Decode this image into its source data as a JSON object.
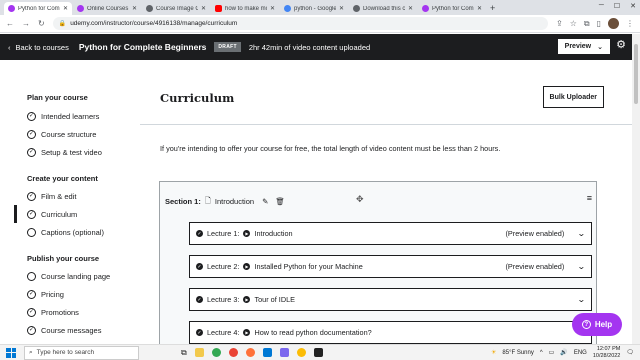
{
  "browser": {
    "tabs": [
      {
        "title": "Python for Comp",
        "color": "#a435f0",
        "active": true
      },
      {
        "title": "Online Courses -",
        "color": "#a435f0",
        "active": false
      },
      {
        "title": "Course Image Gu",
        "color": "#5f6368",
        "active": false
      },
      {
        "title": "how to make mo",
        "color": "#ff0000",
        "active": false
      },
      {
        "title": "python - Google",
        "color": "#4285f4",
        "active": false
      },
      {
        "title": "Download this c",
        "color": "#5f6368",
        "active": false
      },
      {
        "title": "Python for Comp",
        "color": "#a435f0",
        "active": false
      }
    ],
    "new_tab": "+",
    "url": "udemy.com/instructor/course/4916138/manage/curriculum"
  },
  "header": {
    "back_label": "Back to courses",
    "course_title": "Python for Complete Beginners",
    "draft_badge": "DRAFT",
    "uploaded_text": "2hr 42min of video content uploaded",
    "preview_label": "Preview"
  },
  "sidebar": {
    "sections": [
      {
        "title": "Plan your course",
        "items": [
          "Intended learners",
          "Course structure",
          "Setup & test video"
        ]
      },
      {
        "title": "Create your content",
        "items": [
          "Film & edit",
          "Curriculum",
          "Captions (optional)"
        ]
      },
      {
        "title": "Publish your course",
        "items": [
          "Course landing page",
          "Pricing",
          "Promotions",
          "Course messages"
        ]
      }
    ],
    "active_item": "Curriculum"
  },
  "main": {
    "title": "Curriculum",
    "bulk_uploader": "Bulk Uploader",
    "notice": "If you're intending to offer your course for free, the total length of video content must be less than 2 hours.",
    "section": {
      "label": "Section 1:",
      "name": "Introduction"
    },
    "lectures": [
      {
        "label": "Lecture 1:",
        "title": "Introduction",
        "status": "(Preview enabled)"
      },
      {
        "label": "Lecture 2:",
        "title": "Installed Python for your Machine",
        "status": "(Preview enabled)"
      },
      {
        "label": "Lecture 3:",
        "title": "Tour of IDLE",
        "status": ""
      },
      {
        "label": "Lecture 4:",
        "title": "How to read python documentation?",
        "status": ""
      }
    ]
  },
  "help_label": "Help",
  "taskbar": {
    "search_placeholder": "Type here to search",
    "weather": "85°F  Sunny",
    "language": "ENG",
    "time": "12:07 PM",
    "date": "10/28/2022"
  },
  "colors": {
    "accent": "#a435f0",
    "header_bg": "#1c1d1f"
  }
}
